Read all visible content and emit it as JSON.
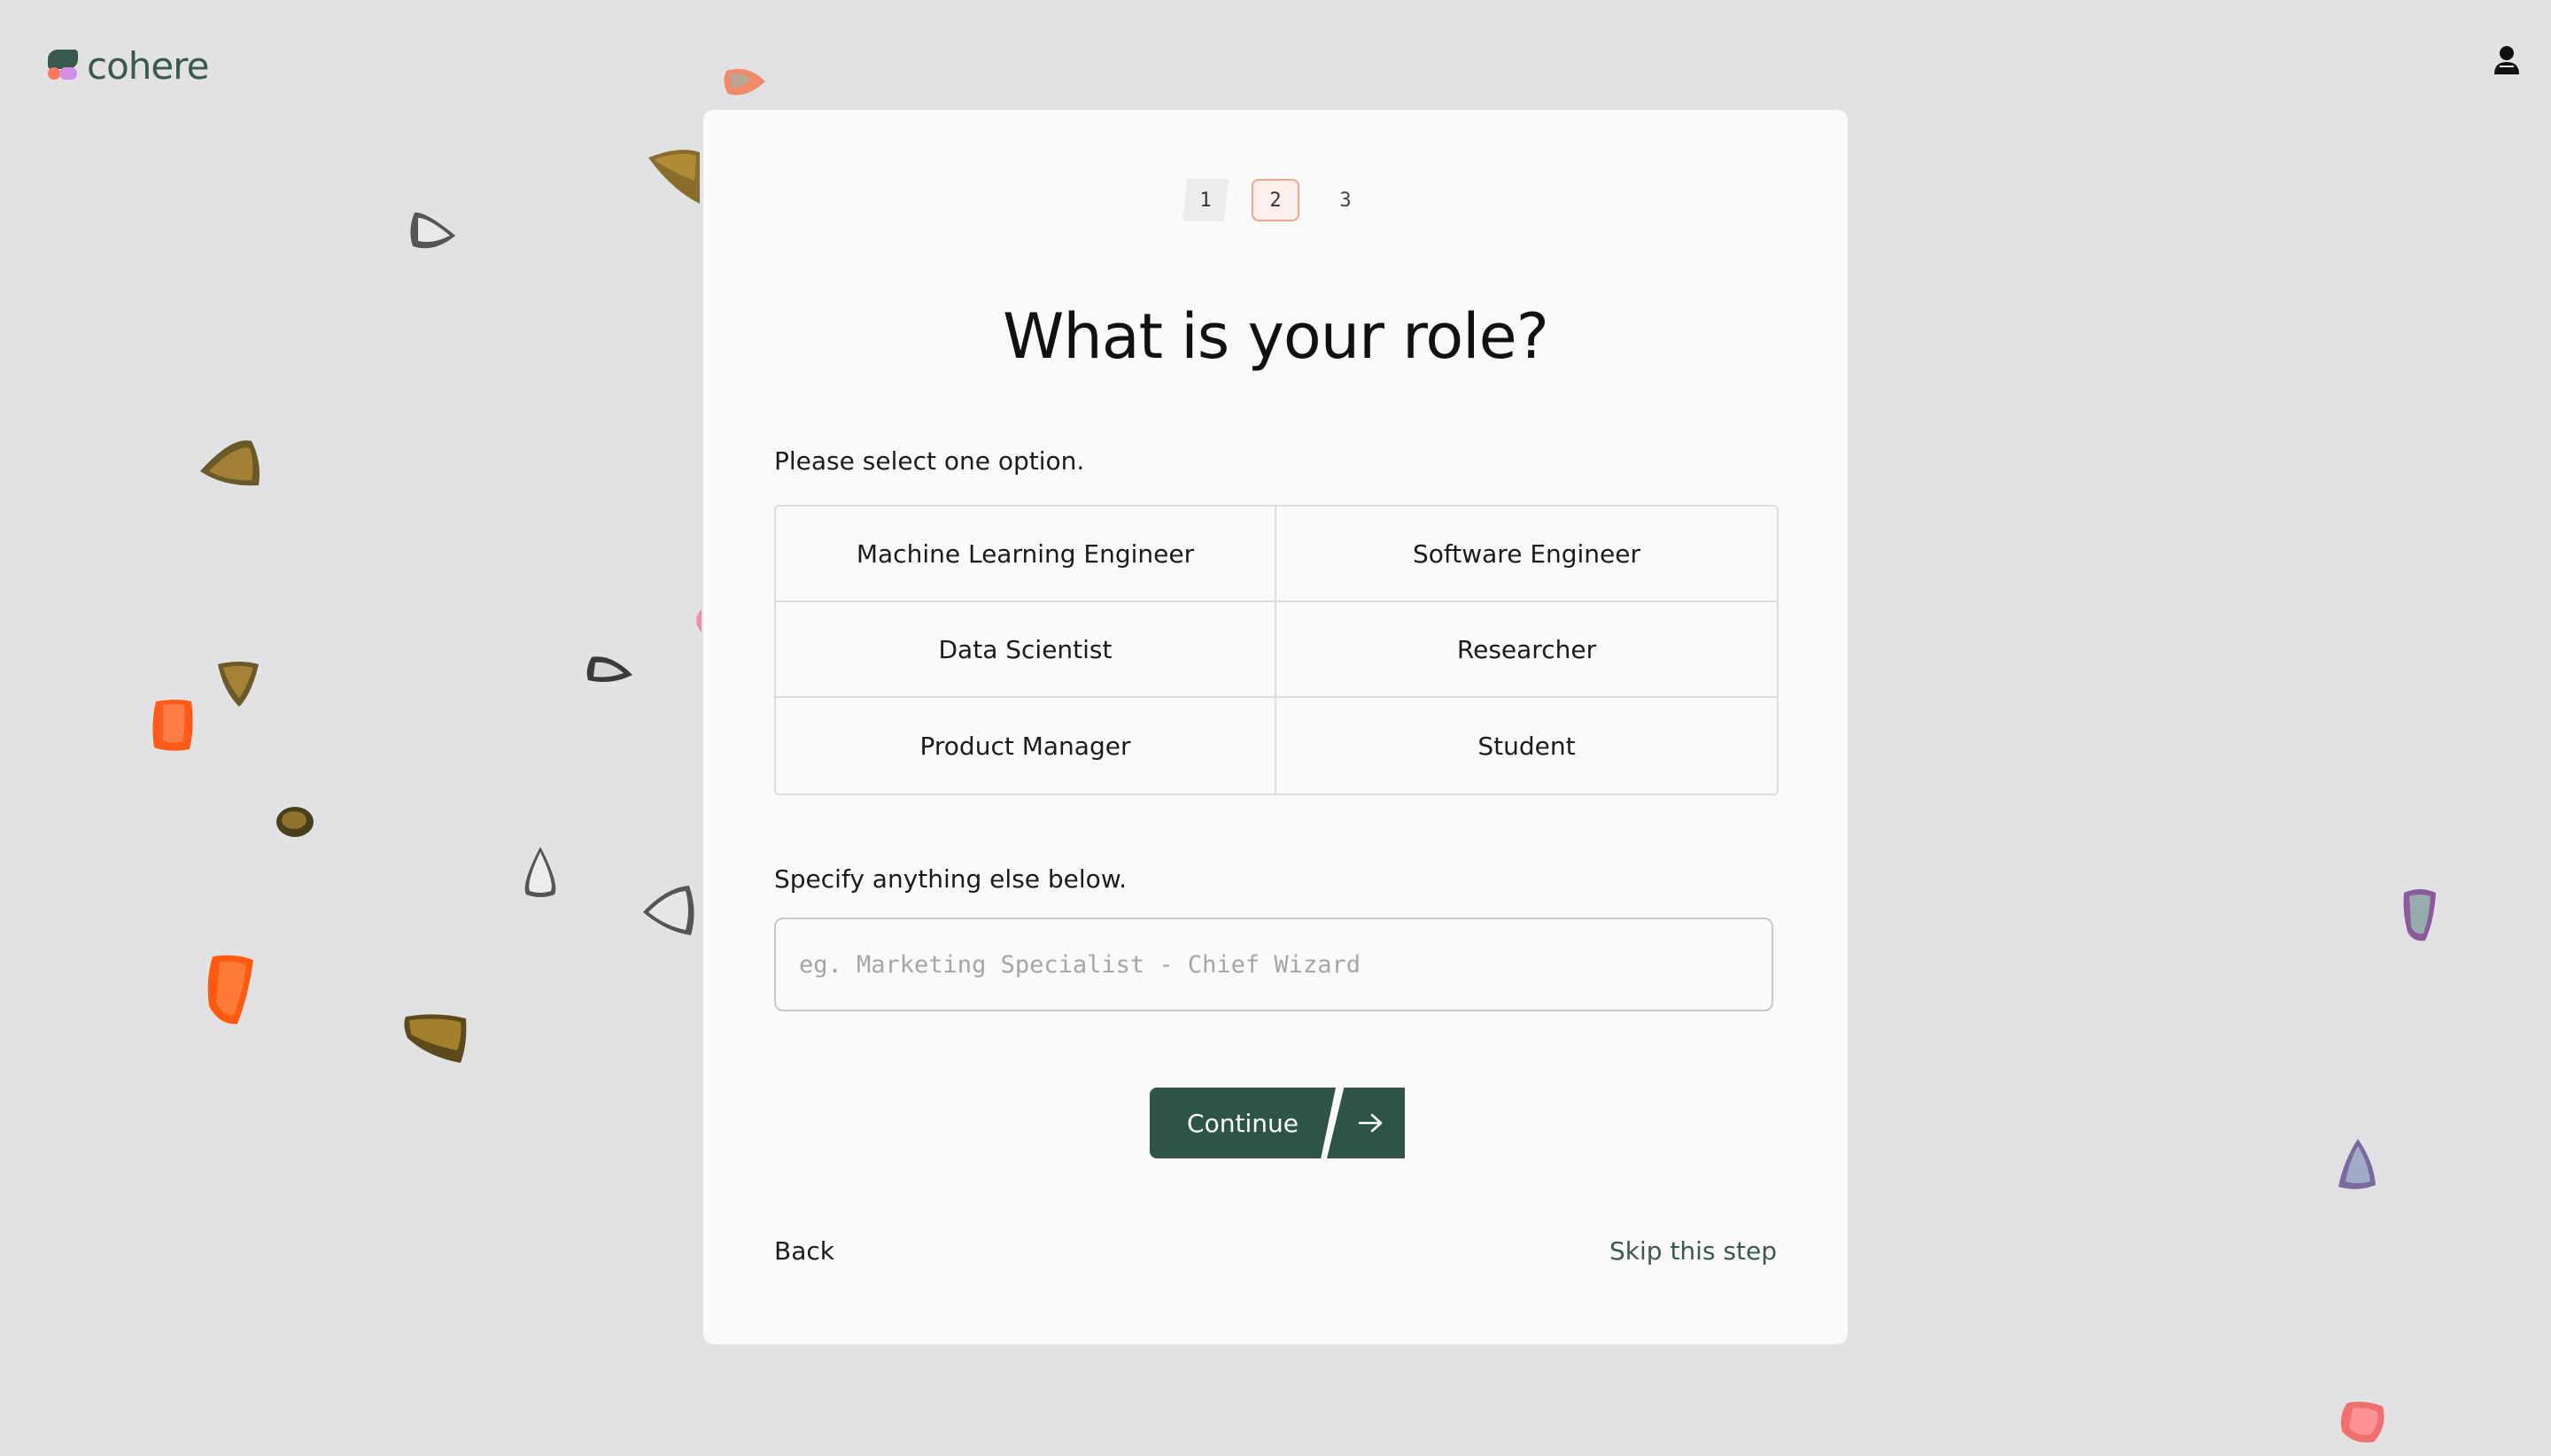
{
  "brand": {
    "name": "cohere"
  },
  "steps": [
    {
      "label": "1",
      "state": "done"
    },
    {
      "label": "2",
      "state": "active"
    },
    {
      "label": "3",
      "state": "todo"
    }
  ],
  "title": "What is your role?",
  "select_prompt": "Please select one option.",
  "options": [
    "Machine Learning Engineer",
    "Software Engineer",
    "Data Scientist",
    "Researcher",
    "Product Manager",
    "Student"
  ],
  "specify_prompt": "Specify anything else below.",
  "specify_input": {
    "value": "",
    "placeholder": "eg. Marketing Specialist - Chief Wizard"
  },
  "continue_label": "Continue",
  "back_label": "Back",
  "skip_label": "Skip this step",
  "colors": {
    "primary": "#2e5448",
    "brand": "#39594d",
    "background": "#e2e1e4",
    "card": "#fafafa",
    "step_active_border": "#e8a590"
  },
  "icons": {
    "user": "user-icon",
    "arrow": "arrow-right-icon"
  }
}
